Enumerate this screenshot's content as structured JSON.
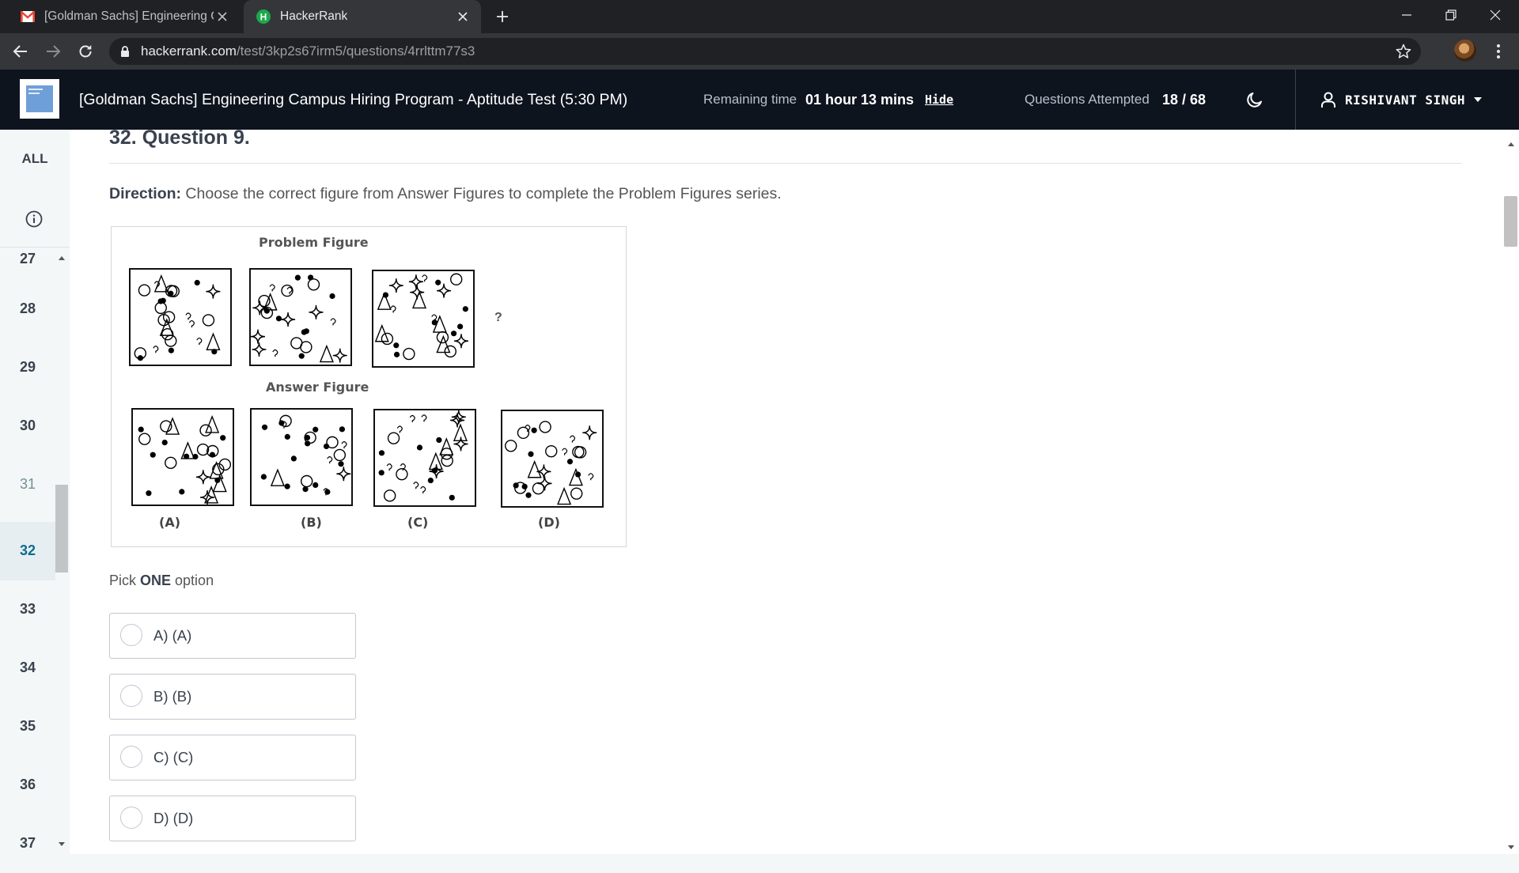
{
  "browser": {
    "tabs": [
      {
        "title": "[Goldman Sachs] Engineering Ca",
        "favicon": "gmail-icon",
        "active": false
      },
      {
        "title": "HackerRank",
        "favicon": "hackerrank-h-icon",
        "active": true
      }
    ],
    "url": {
      "host": "hackerrank.com",
      "path": "/test/3kp2s67irm5/questions/4rrlttm77s3"
    }
  },
  "header": {
    "test_title": "[Goldman Sachs] Engineering Campus Hiring Program - Aptitude Test (5:30 PM)",
    "remaining_label": "Remaining time",
    "remaining_value": "01 hour 13 mins",
    "hide_label": "Hide",
    "attempted_label": "Questions Attempted",
    "attempted_value": "18 / 68",
    "user_name": "RISHIVANT SINGH"
  },
  "sidebar": {
    "all_label": "ALL",
    "items": [
      {
        "num": "27",
        "state": "default"
      },
      {
        "num": "28",
        "state": "default"
      },
      {
        "num": "29",
        "state": "default"
      },
      {
        "num": "30",
        "state": "default"
      },
      {
        "num": "31",
        "state": "visited"
      },
      {
        "num": "32",
        "state": "current"
      },
      {
        "num": "33",
        "state": "default"
      },
      {
        "num": "34",
        "state": "default"
      },
      {
        "num": "35",
        "state": "default"
      },
      {
        "num": "36",
        "state": "default"
      },
      {
        "num": "37",
        "state": "default"
      }
    ]
  },
  "question": {
    "title": "32. Question 9.",
    "direction_label": "Direction:",
    "direction_text": " Choose the correct figure from Answer Figures to complete the Problem Figures series.",
    "figure": {
      "problem_label": "Problem Figure",
      "answer_label": "Answer Figure",
      "missing_mark": "?",
      "answer_letters": [
        "(A)",
        "(B)",
        "(C)",
        "(D)"
      ]
    },
    "pick_prefix": "Pick ",
    "pick_bold": "ONE",
    "pick_suffix": " option",
    "options": [
      "A) (A)",
      "B) (B)",
      "C) (C)",
      "D) (D)"
    ]
  },
  "colors": {
    "header_bg": "#0e141e",
    "chrome_dark": "#202124",
    "chrome_tab": "#35363a",
    "current_question": "#0e6d8f"
  }
}
